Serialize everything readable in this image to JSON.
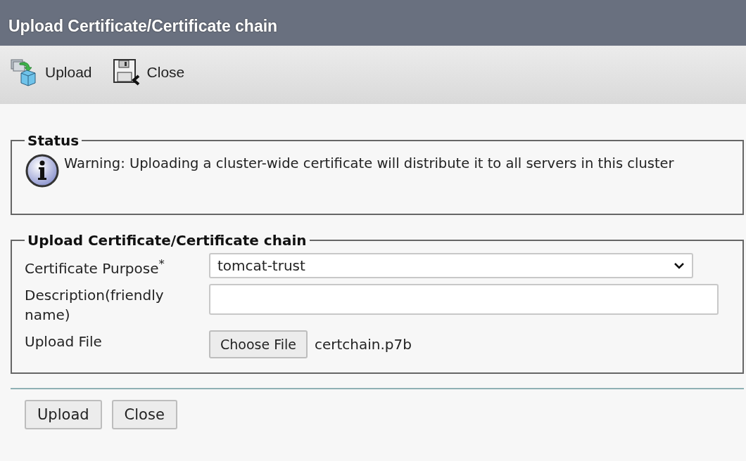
{
  "window": {
    "title": "Upload Certificate/Certificate chain"
  },
  "toolbar": [
    {
      "kind": "upload",
      "label": "Upload"
    },
    {
      "kind": "close",
      "label": "Close"
    }
  ],
  "status": {
    "legend": "Status",
    "message": "Warning: Uploading a cluster-wide certificate will distribute it to all servers in this cluster"
  },
  "form": {
    "legend": "Upload Certificate/Certificate chain",
    "fields": [
      {
        "kind": "select",
        "label": "Certificate Purpose$^{*}$",
        "value": "tomcat-trust"
      },
      {
        "kind": "text",
        "label": "Description(friendly name)"
      },
      {
        "kind": "file",
        "label": "Upload File",
        "button": "Choose File",
        "value": "certchain.p7b"
      }
    ]
  },
  "buttons": [
    "Upload",
    "Close"
  ]
}
